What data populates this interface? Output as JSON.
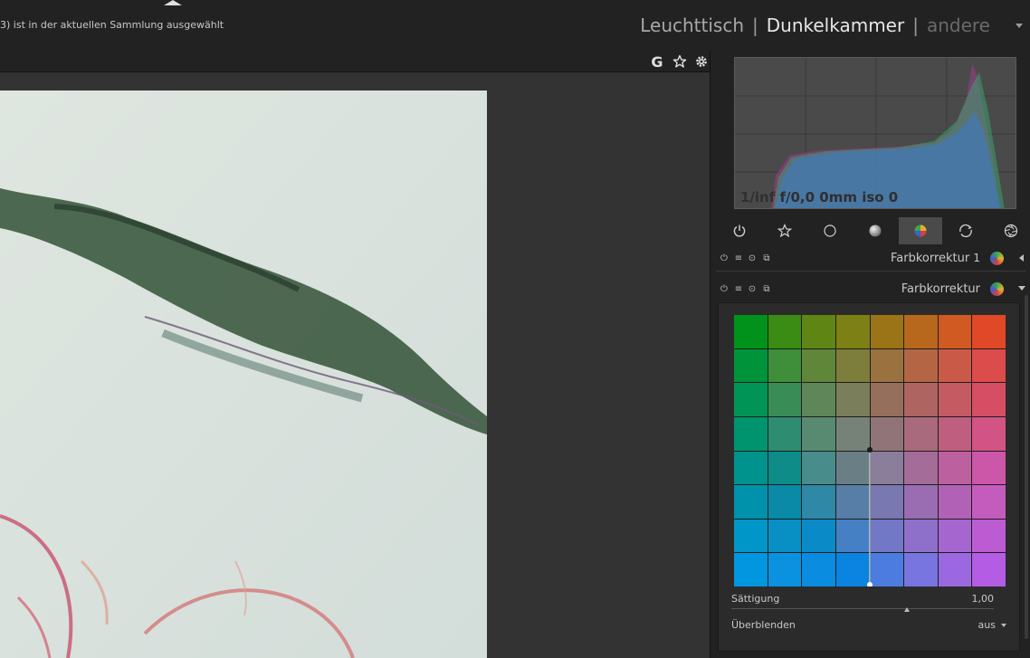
{
  "header": {
    "selection_text": "3) ist in der aktuellen Sammlung ausgewählt",
    "views": {
      "lighttable": "Leuchttisch",
      "darkroom": "Dunkelkammer",
      "other": "andere",
      "separator": "|"
    }
  },
  "toolbar": {
    "g_label": "G",
    "star_icon": "star-outline-icon",
    "gear_icon": "gear-icon"
  },
  "histogram": {
    "exif": "1/inf f/0,0 0mm iso 0"
  },
  "module_groups": [
    {
      "icon": "power-icon",
      "active": false
    },
    {
      "icon": "favorite-star-icon",
      "active": false
    },
    {
      "icon": "circle-outline-icon",
      "active": false
    },
    {
      "icon": "tone-circle-icon",
      "active": false
    },
    {
      "icon": "color-ball-icon",
      "active": true
    },
    {
      "icon": "correct-rotate-icon",
      "active": false
    },
    {
      "icon": "effect-aperture-icon",
      "active": false
    }
  ],
  "modules": [
    {
      "title": "Farbkorrektur",
      "instance": "1",
      "expanded": false
    },
    {
      "title": "Farbkorrektur",
      "instance": "",
      "expanded": true
    }
  ],
  "color_correction": {
    "saturation_label": "Sättigung",
    "saturation_value": "1,00",
    "saturation_level": 0.67,
    "blend_label": "Überblenden",
    "blend_value": "aus",
    "grid_colors": [
      [
        "#00921a",
        "#3a8c14",
        "#5f8614",
        "#7d8014",
        "#9c7418",
        "#b8681c",
        "#d05a22",
        "#e04828"
      ],
      [
        "#00943a",
        "#3e8e3a",
        "#60863a",
        "#7e7e3c",
        "#9a7240",
        "#b46644",
        "#ca5a48",
        "#dc4c4a"
      ],
      [
        "#009456",
        "#3a8c56",
        "#5e8658",
        "#7a7e5a",
        "#966e5c",
        "#ae6460",
        "#c45a62",
        "#d64e64"
      ],
      [
        "#00946e",
        "#2e8c70",
        "#588a72",
        "#768278",
        "#907478",
        "#a86a7c",
        "#c05e80",
        "#d25484"
      ],
      [
        "#00928c",
        "#0e8c88",
        "#488c8c",
        "#6a7e86",
        "#8a7e9a",
        "#a46c98",
        "#bc60a0",
        "#cc56a8"
      ],
      [
        "#0092aa",
        "#0a8aa6",
        "#2e88a6",
        "#567ea6",
        "#7a78b0",
        "#9a6cb2",
        "#b262b6",
        "#c45cbe"
      ],
      [
        "#0096c8",
        "#0890c4",
        "#0a8ac6",
        "#4680c4",
        "#7278c6",
        "#8e70ca",
        "#a666d0",
        "#bc5cd2"
      ],
      [
        "#0096e0",
        "#0a92e0",
        "#0a8ce0",
        "#0a84e0",
        "#4c7ce0",
        "#7874e0",
        "#9c68e2",
        "#b45ce4"
      ]
    ]
  },
  "colors": {
    "accent_grey": "#4a4a4a",
    "panel_bg": "#222222",
    "center_bg": "#333333"
  }
}
